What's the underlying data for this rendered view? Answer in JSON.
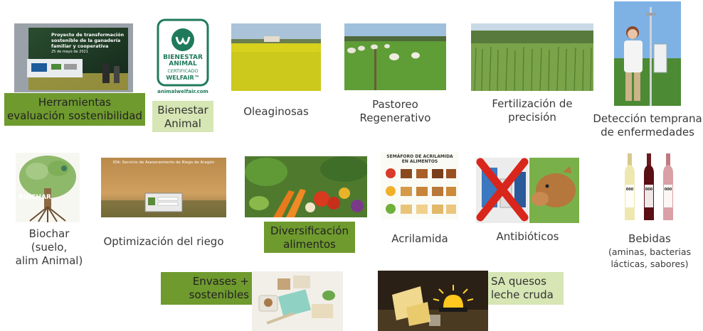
{
  "tiles": {
    "herramientas": {
      "label_line1": "Herramientas",
      "label_line2": "evaluación sostenibilidad",
      "photo_text_1": "Proyecto de transformación",
      "photo_text_2": "sostenible de la ganadería",
      "photo_text_3": "familiar y cooperativa",
      "photo_date": "25 de mayo de 2021"
    },
    "bienestar": {
      "label_line1": "Bienestar",
      "label_line2": "Animal",
      "logo_line1": "BIENESTAR",
      "logo_line2": "ANIMAL",
      "logo_line3": "CERTIFICADO",
      "logo_line4": "WELFAIR™",
      "logo_url": "animalwelfair.com"
    },
    "oleaginosas": {
      "label": "Oleaginosas"
    },
    "pastoreo": {
      "label_line1": "Pastoreo",
      "label_line2": "Regenerativo"
    },
    "fertilizacion": {
      "label_line1": "Fertilización de",
      "label_line2": "precisión"
    },
    "deteccion": {
      "label_line1": "Detección temprana",
      "label_line2": "de enfermedades"
    },
    "biochar": {
      "label_line1": "Biochar",
      "label_line2": "(suelo,",
      "label_line3": "alim Animal)",
      "photo_text": "BIOCHAR"
    },
    "riego": {
      "label": "Optimización del riego",
      "photo_title": "IDA: Servicio de Asesoramiento de Riego de Aragón"
    },
    "diversificacion": {
      "label_line1": "Diversificación",
      "label_line2": "alimentos"
    },
    "acrilamida": {
      "label": "Acrilamida",
      "photo_title_1": "SEMÁFORO DE ACRILAMIDA",
      "photo_title_2": "EN ALIMENTOS"
    },
    "antibioticos": {
      "label": "Antibióticos"
    },
    "bebidas": {
      "label": "Bebidas",
      "sub_line1": "(aminas, bacterias",
      "sub_line2": "lácticas, sabores)",
      "bottle_label": "000"
    },
    "envases": {
      "label_line1": "Envases +",
      "label_line2": "sostenibles"
    },
    "quesos": {
      "label_line1": "SA quesos",
      "label_line2": "leche cruda"
    }
  },
  "colors": {
    "dark_green": "#6f9a2e",
    "light_green": "#d6e6b4",
    "text": "#3a3a3a",
    "logo_green": "#1f7a5c"
  }
}
